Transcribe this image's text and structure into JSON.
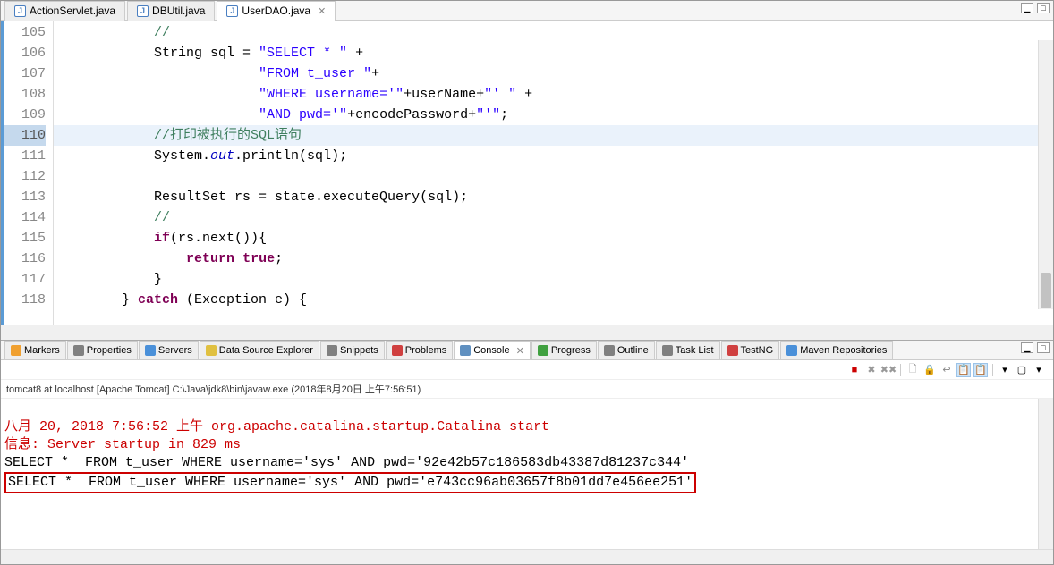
{
  "editor": {
    "tabs": [
      {
        "label": "ActionServlet.java",
        "active": false
      },
      {
        "label": "DBUtil.java",
        "active": false
      },
      {
        "label": "UserDAO.java",
        "active": true
      }
    ],
    "lines": [
      {
        "n": "105",
        "indent": "            ",
        "tokens": [
          {
            "t": "//",
            "c": "cmt"
          }
        ]
      },
      {
        "n": "106",
        "indent": "            ",
        "tokens": [
          {
            "t": "String sql = "
          },
          {
            "t": "\"SELECT * \"",
            "c": "str"
          },
          {
            "t": " +"
          }
        ]
      },
      {
        "n": "107",
        "indent": "                         ",
        "tokens": [
          {
            "t": "\"FROM t_user \"",
            "c": "str"
          },
          {
            "t": "+"
          }
        ]
      },
      {
        "n": "108",
        "indent": "                         ",
        "tokens": [
          {
            "t": "\"WHERE username='\"",
            "c": "str"
          },
          {
            "t": "+userName+"
          },
          {
            "t": "\"' \"",
            "c": "str"
          },
          {
            "t": " +"
          }
        ]
      },
      {
        "n": "109",
        "indent": "                         ",
        "tokens": [
          {
            "t": "\"AND pwd='\"",
            "c": "str"
          },
          {
            "t": "+encodePassword+"
          },
          {
            "t": "\"'\"",
            "c": "str"
          },
          {
            "t": ";"
          }
        ]
      },
      {
        "n": "110",
        "indent": "            ",
        "hl": true,
        "tokens": [
          {
            "t": "//打印被执行的SQL语句",
            "c": "cmt"
          }
        ]
      },
      {
        "n": "111",
        "indent": "            ",
        "tokens": [
          {
            "t": "System."
          },
          {
            "t": "out",
            "c": "static"
          },
          {
            "t": ".println(sql);"
          }
        ]
      },
      {
        "n": "112",
        "indent": "",
        "tokens": []
      },
      {
        "n": "113",
        "indent": "            ",
        "tokens": [
          {
            "t": "ResultSet rs = state.executeQuery(sql);"
          }
        ]
      },
      {
        "n": "114",
        "indent": "            ",
        "tokens": [
          {
            "t": "//",
            "c": "cmt"
          }
        ]
      },
      {
        "n": "115",
        "indent": "            ",
        "tokens": [
          {
            "t": "if",
            "c": "kw"
          },
          {
            "t": "(rs.next()){"
          }
        ]
      },
      {
        "n": "116",
        "indent": "                ",
        "tokens": [
          {
            "t": "return",
            "c": "kw"
          },
          {
            "t": " "
          },
          {
            "t": "true",
            "c": "kw"
          },
          {
            "t": ";"
          }
        ]
      },
      {
        "n": "117",
        "indent": "            ",
        "tokens": [
          {
            "t": "}"
          }
        ]
      },
      {
        "n": "118",
        "indent": "        ",
        "tokens": [
          {
            "t": "} "
          },
          {
            "t": "catch",
            "c": "kw"
          },
          {
            "t": " (Exception e) {"
          }
        ]
      }
    ]
  },
  "views": {
    "tabs": [
      {
        "label": "Markers",
        "icon": "#f0a030"
      },
      {
        "label": "Properties",
        "icon": "#808080"
      },
      {
        "label": "Servers",
        "icon": "#4a90d9"
      },
      {
        "label": "Data Source Explorer",
        "icon": "#e0c040"
      },
      {
        "label": "Snippets",
        "icon": "#808080"
      },
      {
        "label": "Problems",
        "icon": "#d04040"
      },
      {
        "label": "Console",
        "icon": "#6090c0",
        "active": true
      },
      {
        "label": "Progress",
        "icon": "#40a040"
      },
      {
        "label": "Outline",
        "icon": "#808080"
      },
      {
        "label": "Task List",
        "icon": "#808080"
      },
      {
        "label": "TestNG",
        "icon": "#d04040"
      },
      {
        "label": "Maven Repositories",
        "icon": "#4a90d9"
      }
    ]
  },
  "console": {
    "status": "tomcat8 at localhost [Apache Tomcat] C:\\Java\\jdk8\\bin\\javaw.exe (2018年8月20日 上午7:56:51)",
    "line1": "八月 20, 2018 7:56:52 上午 org.apache.catalina.startup.Catalina start",
    "line2": "信息: Server startup in 829 ms",
    "line3": "SELECT *  FROM t_user WHERE username='sys' AND pwd='92e42b57c186583db43387d81237c344'",
    "line4": "SELECT *  FROM t_user WHERE username='sys' AND pwd='e743cc96ab03657f8b01dd7e456ee251'"
  }
}
